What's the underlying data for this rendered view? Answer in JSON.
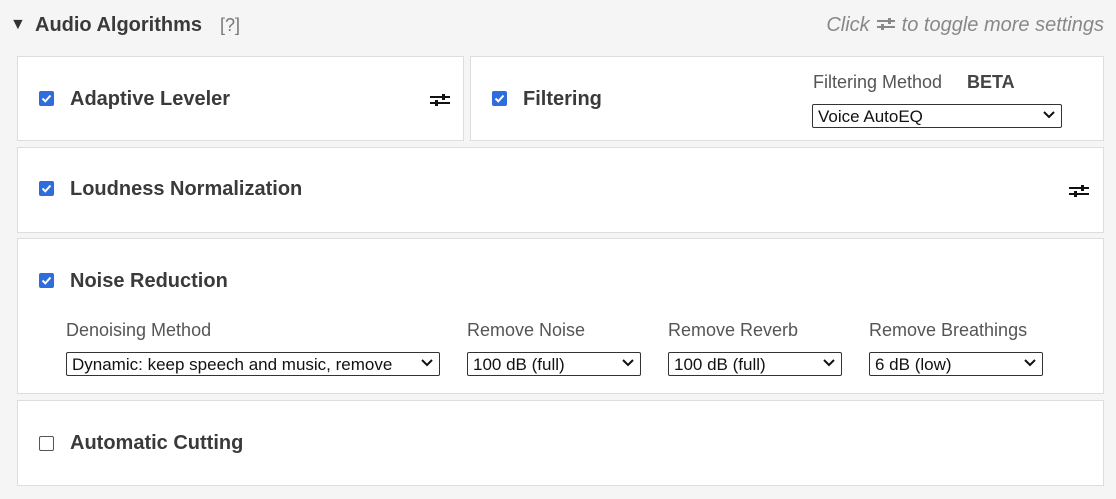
{
  "header": {
    "title": "Audio Algorithms",
    "help": "[?]",
    "hint_before": "Click",
    "hint_after": "to toggle more settings",
    "hint_icon": "sliders-icon"
  },
  "adaptive_leveler": {
    "label": "Adaptive Leveler",
    "checked": true
  },
  "filtering": {
    "label": "Filtering",
    "checked": true,
    "method_label": "Filtering Method",
    "badge": "BETA",
    "method_value": "Voice AutoEQ"
  },
  "loudness": {
    "label": "Loudness Normalization",
    "checked": true
  },
  "noise": {
    "label": "Noise Reduction",
    "checked": true,
    "fields": [
      {
        "label": "Denoising Method",
        "value": "Dynamic: keep speech and music, remove"
      },
      {
        "label": "Remove Noise",
        "value": "100 dB (full)"
      },
      {
        "label": "Remove Reverb",
        "value": "100 dB (full)"
      },
      {
        "label": "Remove Breathings",
        "value": "6 dB (low)"
      }
    ]
  },
  "cutting": {
    "label": "Automatic Cutting",
    "checked": false
  },
  "colors": {
    "accent": "#2e6ddb",
    "background": "#f5f5f5",
    "panel": "#ffffff"
  }
}
